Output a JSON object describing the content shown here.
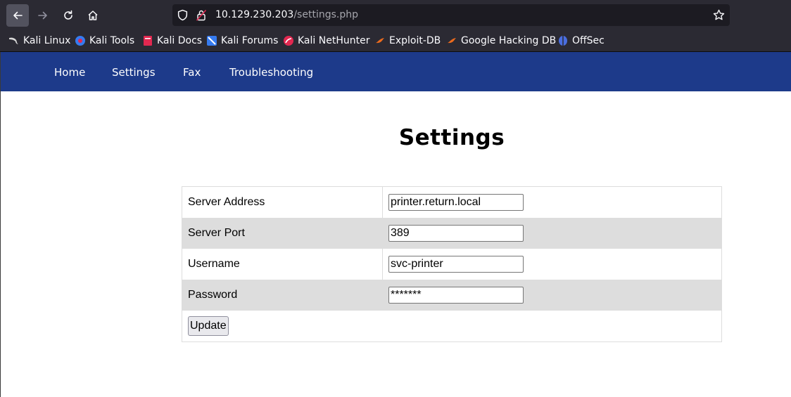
{
  "browser": {
    "url_host": "10.129.230.203",
    "url_path": "/settings.php",
    "bookmarks": [
      {
        "label": "Kali Linux",
        "icon": "kali-dragon-icon"
      },
      {
        "label": "Kali Tools",
        "icon": "kali-tools-icon"
      },
      {
        "label": "Kali Docs",
        "icon": "kali-docs-icon"
      },
      {
        "label": "Kali Forums",
        "icon": "kali-forums-icon"
      },
      {
        "label": "Kali NetHunter",
        "icon": "kali-nethunter-icon"
      },
      {
        "label": "Exploit-DB",
        "icon": "exploit-db-icon"
      },
      {
        "label": "Google Hacking DB",
        "icon": "google-hacking-db-icon"
      },
      {
        "label": "OffSec",
        "icon": "offsec-icon"
      }
    ]
  },
  "nav": {
    "items": [
      "Home",
      "Settings",
      "Fax",
      "Troubleshooting"
    ],
    "bg_color": "#1d3a8a"
  },
  "page": {
    "title": "Settings",
    "form": {
      "rows": [
        {
          "label": "Server Address",
          "value": "printer.return.local"
        },
        {
          "label": "Server Port",
          "value": "389"
        },
        {
          "label": "Username",
          "value": "svc-printer"
        },
        {
          "label": "Password",
          "value": "*******"
        }
      ],
      "submit_label": "Update"
    }
  }
}
